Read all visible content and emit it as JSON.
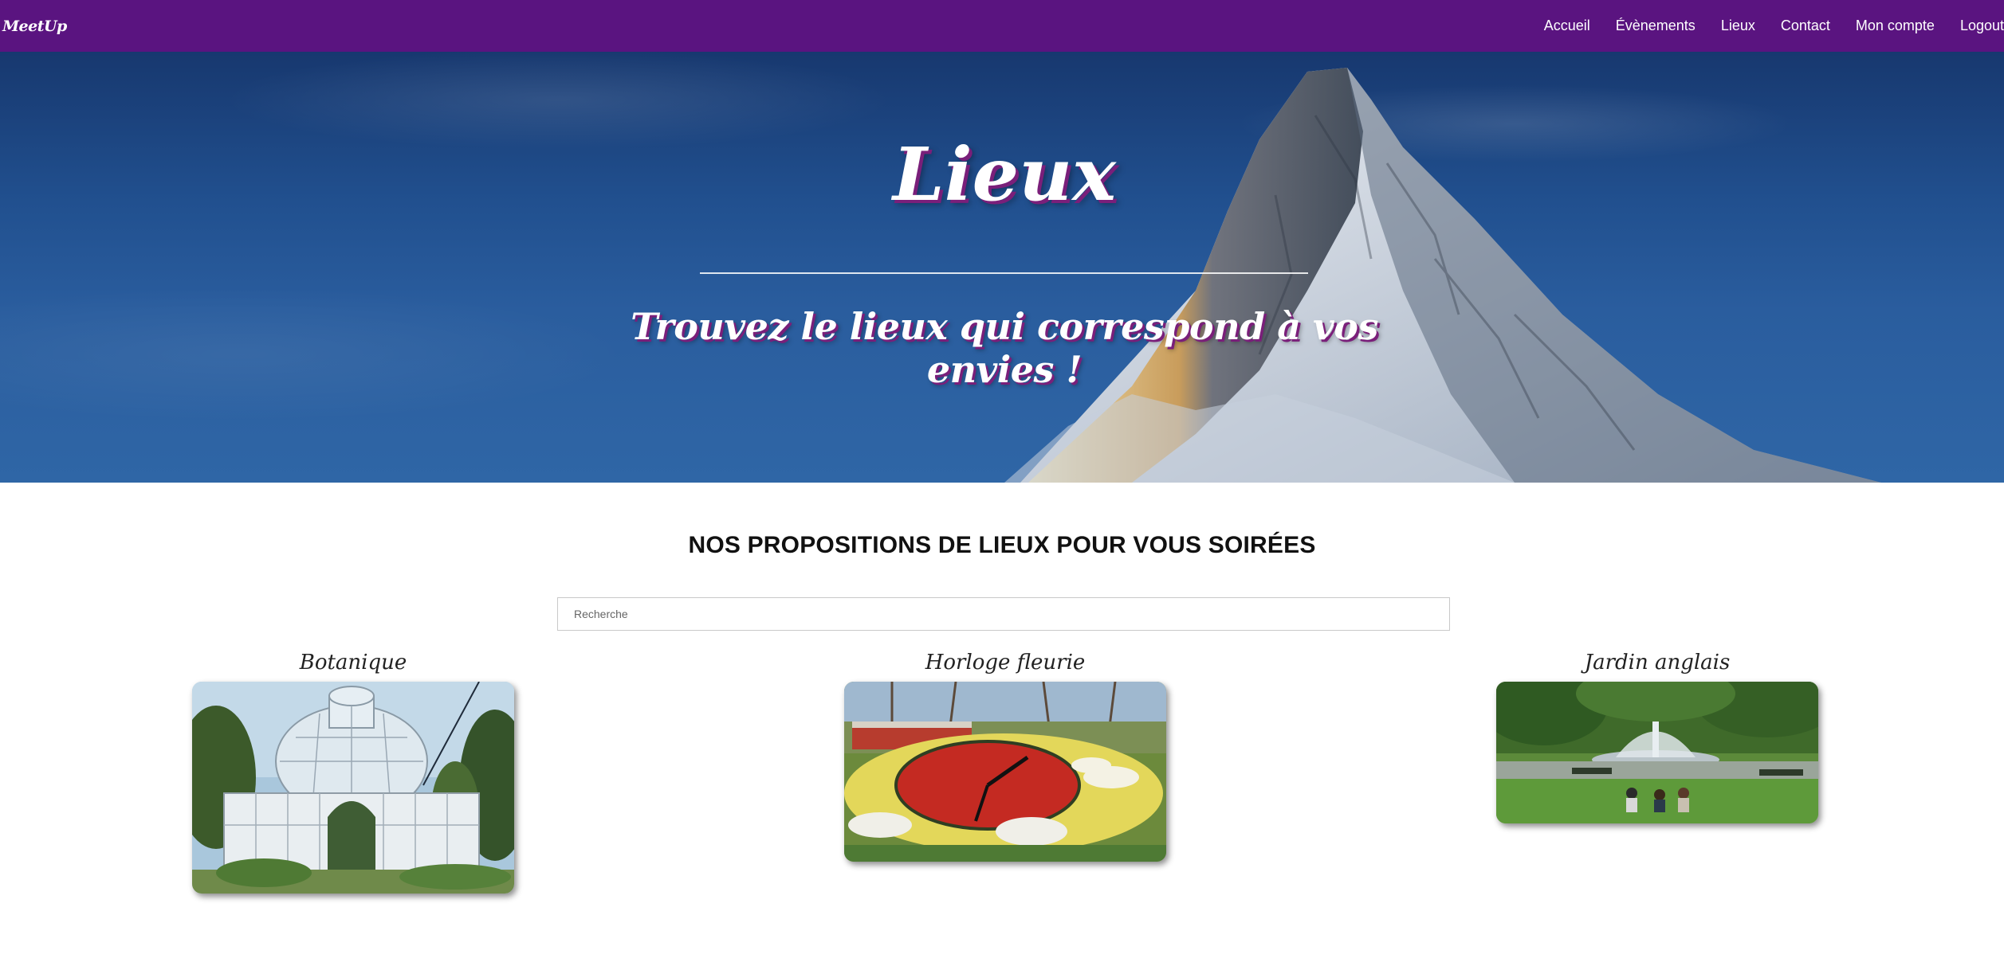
{
  "navbar": {
    "brand": "MeetUp",
    "links": [
      "Accueil",
      "Évènements",
      "Lieux",
      "Contact",
      "Mon compte",
      "Logout"
    ]
  },
  "hero": {
    "title": "Lieux",
    "subtitle": "Trouvez le lieux qui correspond à vos envies !"
  },
  "section": {
    "title": "NOS PROPOSITIONS DE LIEUX POUR VOUS SOIRÉES"
  },
  "search": {
    "placeholder": "Recherche"
  },
  "places": [
    {
      "name": "Botanique",
      "image": "greenhouse-photo"
    },
    {
      "name": "Horloge fleurie",
      "image": "flower-clock-photo"
    },
    {
      "name": "Jardin anglais",
      "image": "fountain-park-photo"
    }
  ],
  "colors": {
    "navbar": "#5a1480",
    "title_shadow": "#7a1f7a",
    "sky": "#21508f"
  }
}
